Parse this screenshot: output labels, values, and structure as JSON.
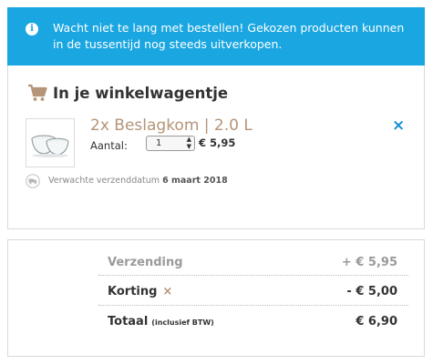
{
  "notice": {
    "icon": "info-icon",
    "text": "Wacht niet te lang met bestellen! Gekozen producten kunnen in de tussentijd nog steeds uitverkopen."
  },
  "cart": {
    "icon": "cart-icon",
    "title": "In je winkelwagentje",
    "item": {
      "name": "2x Beslagkom | 2.0 L",
      "quantity_label": "Aantal:",
      "quantity": "1",
      "price": "€ 5,95",
      "remove": "×"
    },
    "shipping": {
      "icon": "truck-icon",
      "text": "Verwachte verzenddatum",
      "date": "6 maart 2018"
    }
  },
  "totals": {
    "shipping_label": "Verzending",
    "shipping_value": "+  € 5,95",
    "discount_label": "Korting",
    "discount_remove": "×",
    "discount_value": "-  € 5,00",
    "total_label": "Totaal",
    "total_note": "(inclusief BTW)",
    "total_value": "€ 6,90"
  },
  "colors": {
    "notice_bg": "#1aa6e0",
    "accent_brown": "#b59478",
    "remove_blue": "#1a8fd6"
  }
}
